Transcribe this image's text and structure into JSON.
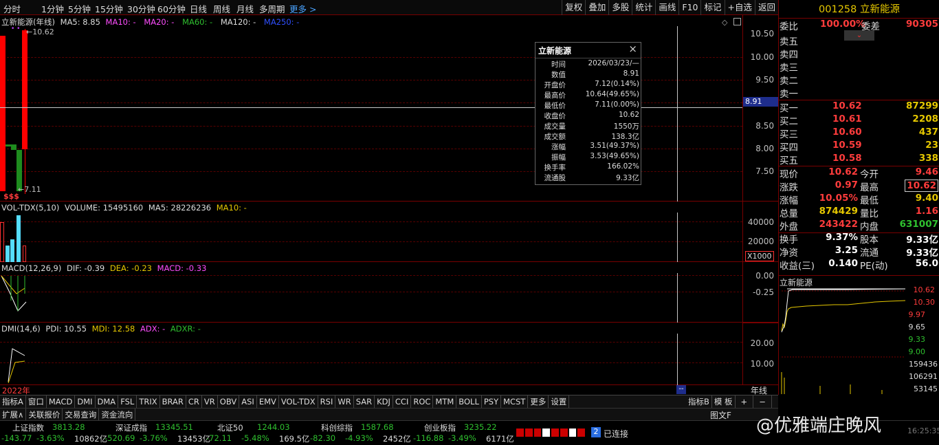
{
  "periods": [
    "分时",
    "1分钟",
    "5分钟",
    "15分钟",
    "30分钟",
    "60分钟",
    "日线",
    "周线",
    "月线",
    "多周期",
    "更多 >"
  ],
  "toolbar": [
    "复权",
    "叠加",
    "多股",
    "统计",
    "画线",
    "F10",
    "标记",
    "+自选",
    "返回"
  ],
  "main": {
    "title": "立新能源(年线)",
    "ma5": "MA5: 8.85",
    "ma10": "MA10: -",
    "ma20": "MA20: -",
    "ma60": "MA60: -",
    "ma120": "MA120: -",
    "ma250": "MA250: -",
    "high_label": "10.62",
    "low_label": "7.11",
    "marks": "$$$",
    "yticks": [
      "10.50",
      "10.00",
      "9.50",
      "9.00",
      "8.50",
      "8.00",
      "7.50"
    ],
    "cursor_price": "8.91"
  },
  "vol": {
    "title": "VOL-TDX(5,10)",
    "volume": "VOLUME: 15495160",
    "ma5": "MA5: 28226236",
    "ma10": "MA10: -",
    "yticks": [
      "40000",
      "20000"
    ],
    "unit": "X1000"
  },
  "macd": {
    "title": "MACD(12,26,9)",
    "dif": "DIF: -0.39",
    "dea": "DEA: -0.23",
    "macd": "MACD: -0.33",
    "yticks": [
      "0.00",
      "-0.25"
    ]
  },
  "dmi": {
    "title": "DMI(14,6)",
    "pdi": "PDI: 10.55",
    "mdi": "MDI: 12.58",
    "adx": "ADX: -",
    "adxr": "ADXR: -",
    "yticks": [
      "20.00",
      "10.00"
    ]
  },
  "xaxis": {
    "year": "2022年",
    "cursor": "--",
    "period": "年线"
  },
  "tooltip": {
    "title": "立新能源",
    "close_icon": "×",
    "rows": [
      {
        "k": "时间",
        "v": "2026/03/23/—",
        "c": "wht"
      },
      {
        "k": "数值",
        "v": "8.91",
        "c": "wht"
      },
      {
        "k": "开盘价",
        "v": "7.12(0.14%)",
        "c": "red"
      },
      {
        "k": "最高价",
        "v": "10.64(49.65%)",
        "c": "red"
      },
      {
        "k": "最低价",
        "v": "7.11(0.00%)",
        "c": "wht"
      },
      {
        "k": "收盘价",
        "v": "10.62",
        "c": "red"
      },
      {
        "k": "成交量",
        "v": "1550万",
        "c": "yel"
      },
      {
        "k": "成交额",
        "v": "138.3亿",
        "c": "wht"
      },
      {
        "k": "涨幅",
        "v": "3.51(49.37%)",
        "c": "red"
      },
      {
        "k": "振幅",
        "v": "3.53(49.65%)",
        "c": "wht"
      },
      {
        "k": "换手率",
        "v": "166.02%",
        "c": "wht"
      },
      {
        "k": "流通股",
        "v": "9.33亿",
        "c": "wht"
      }
    ]
  },
  "quote": {
    "code_name": "001258 立新能源",
    "webi_label": "委比",
    "webi": "100.00%",
    "weicha_label": "委差",
    "weicha": "90305",
    "sells": [
      "卖五",
      "卖四",
      "卖三",
      "卖二",
      "卖一"
    ],
    "buys": [
      {
        "l": "买一",
        "p": "10.62",
        "v": "87299"
      },
      {
        "l": "买二",
        "p": "10.61",
        "v": "2208"
      },
      {
        "l": "买三",
        "p": "10.60",
        "v": "437"
      },
      {
        "l": "买四",
        "p": "10.59",
        "v": "23"
      },
      {
        "l": "买五",
        "p": "10.58",
        "v": "338"
      }
    ],
    "stats": [
      {
        "a": "现价",
        "av": "10.62",
        "ac": "red",
        "b": "今开",
        "bv": "9.46",
        "bc": "red"
      },
      {
        "a": "涨跌",
        "av": "0.97",
        "ac": "red",
        "b": "最高",
        "bv": "10.62",
        "bc": "red"
      },
      {
        "a": "涨幅",
        "av": "10.05%",
        "ac": "red",
        "b": "最低",
        "bv": "9.40",
        "bc": "yel"
      },
      {
        "a": "总量",
        "av": "874429",
        "ac": "yel",
        "b": "量比",
        "bv": "1.16",
        "bc": "red"
      },
      {
        "a": "外盘",
        "av": "243422",
        "ac": "red",
        "b": "内盘",
        "bv": "631007",
        "bc": "grn"
      },
      {
        "a": "换手",
        "av": "9.37%",
        "ac": "wht",
        "b": "股本",
        "bv": "9.33亿",
        "bc": "wht"
      },
      {
        "a": "净资",
        "av": "3.25",
        "ac": "wht",
        "b": "流通",
        "bv": "9.33亿",
        "bc": "wht"
      },
      {
        "a": "收益(三)",
        "av": "0.140",
        "ac": "wht",
        "b": "PE(动)",
        "bv": "56.0",
        "bc": "wht"
      }
    ]
  },
  "mini": {
    "title": "立新能源",
    "prices": [
      "10.62",
      "10.30",
      "9.97",
      "9.65",
      "9.33",
      "9.00"
    ],
    "vols": [
      "159436",
      "106291",
      "53145"
    ]
  },
  "tabs1": [
    "指标A",
    "窗口",
    "MACD",
    "DMI",
    "DMA",
    "FSL",
    "TRIX",
    "BRAR",
    "CR",
    "VR",
    "OBV",
    "ASI",
    "EMV",
    "VOL-TDX",
    "RSI",
    "WR",
    "SAR",
    "KDJ",
    "CCI",
    "ROC",
    "MTM",
    "BOLL",
    "PSY",
    "MCST",
    "更多",
    "设置"
  ],
  "tabs1_right": [
    "指标B",
    "模 板",
    "+",
    "−"
  ],
  "tabs2": [
    "扩展∧",
    "关联报价",
    "交易查询",
    "资金流向"
  ],
  "status": [
    {
      "name": "上证指数",
      "val": "3813.28",
      "chg": "-143.77",
      "pct": "-3.63%",
      "amt": "10862亿"
    },
    {
      "name": "深证成指",
      "val": "13345.51",
      "chg": "-520.69",
      "pct": "-3.76%",
      "amt": "13453亿"
    },
    {
      "name": "北证50",
      "val": "1244.03",
      "chg": "-72.11",
      "pct": "-5.48%",
      "amt": "169.5亿"
    },
    {
      "name": "科创综指",
      "val": "1587.68",
      "chg": "-82.30",
      "pct": "-4.93%",
      "amt": "2452亿"
    },
    {
      "name": "创业板指",
      "val": "3235.22",
      "chg": "-116.88",
      "pct": "-3.49%",
      "amt": "6171亿"
    }
  ],
  "conn": {
    "num": "2",
    "text": "已连接"
  },
  "watermark": "@优雅端庄晚风",
  "time": "16:25:35",
  "bottom_right_tab": "图文F"
}
